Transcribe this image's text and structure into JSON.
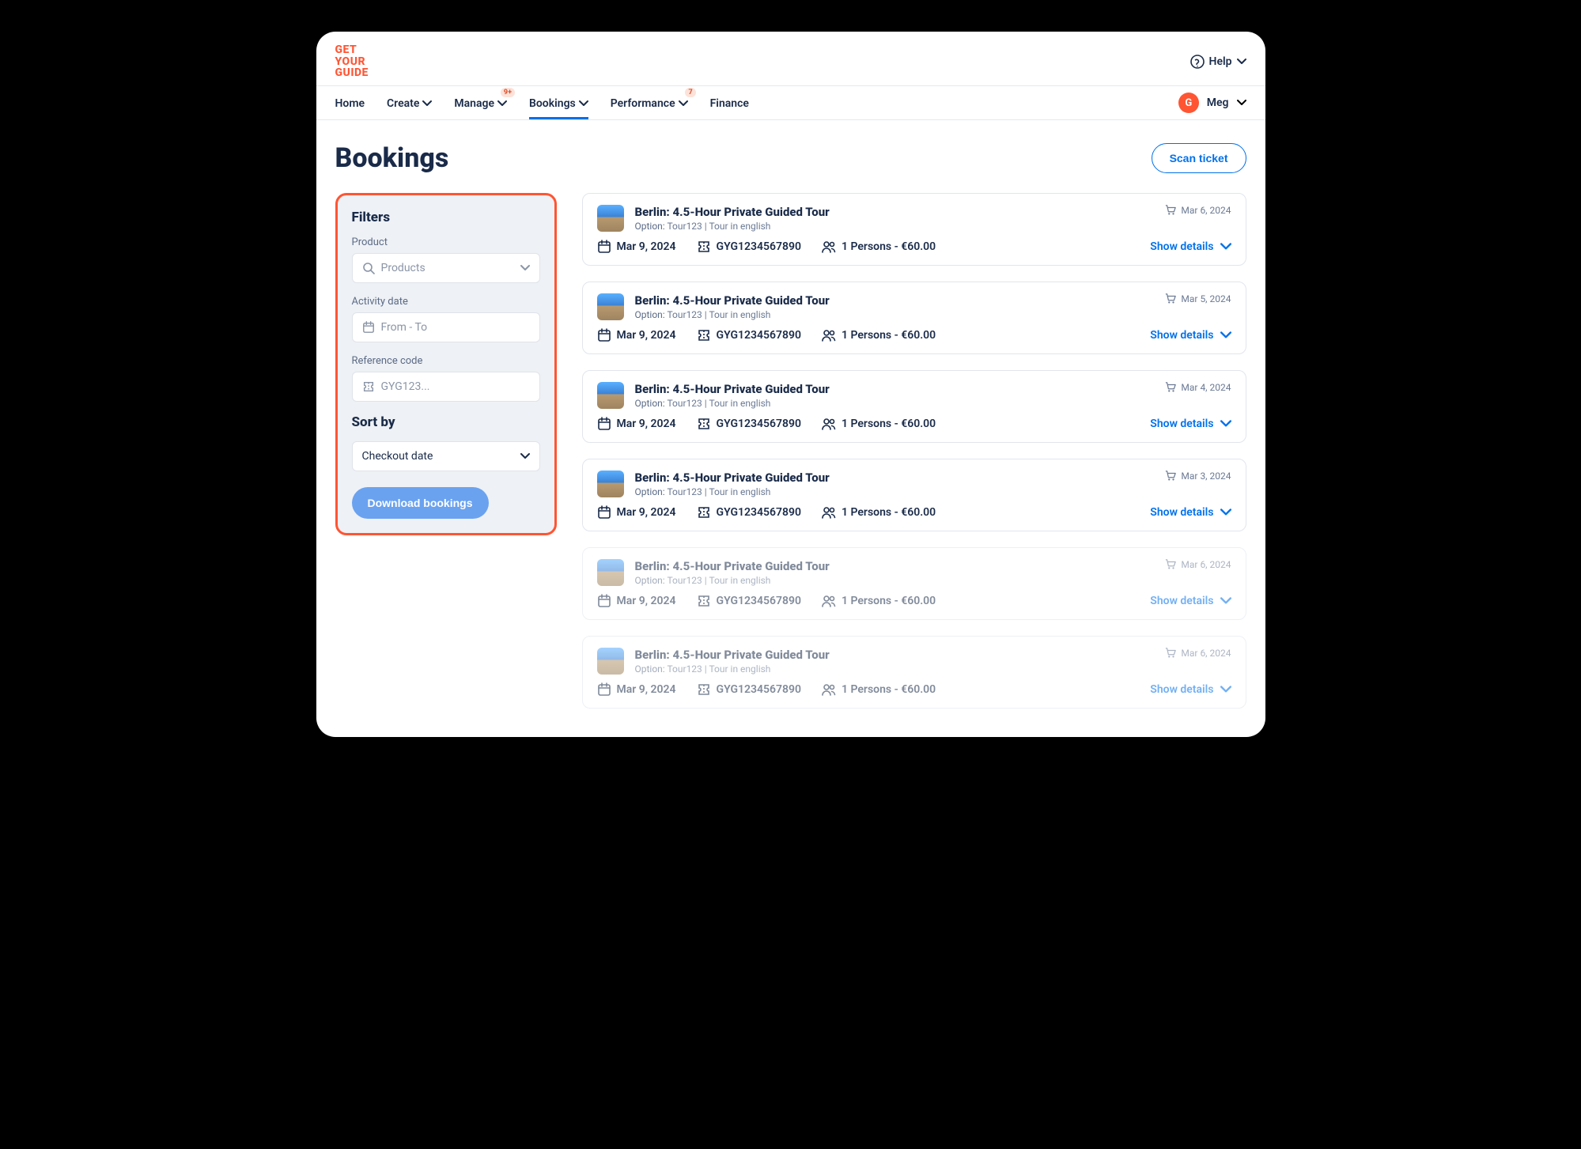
{
  "brand": {
    "line1": "GET",
    "line2": "YOUR",
    "line3": "GUIDE"
  },
  "help_label": "Help",
  "nav": {
    "items": [
      {
        "label": "Home",
        "dropdown": false,
        "badge": ""
      },
      {
        "label": "Create",
        "dropdown": true,
        "badge": ""
      },
      {
        "label": "Manage",
        "dropdown": true,
        "badge": "9+"
      },
      {
        "label": "Bookings",
        "dropdown": true,
        "badge": "",
        "active": true
      },
      {
        "label": "Performance",
        "dropdown": true,
        "badge": "7"
      },
      {
        "label": "Finance",
        "dropdown": false,
        "badge": ""
      }
    ]
  },
  "user": {
    "initial": "G",
    "name": "Meg"
  },
  "page": {
    "title": "Bookings",
    "scan_label": "Scan ticket"
  },
  "filters": {
    "heading": "Filters",
    "product_label": "Product",
    "product_placeholder": "Products",
    "date_label": "Activity date",
    "date_placeholder": "From - To",
    "ref_label": "Reference code",
    "ref_placeholder": "GYG123...",
    "sort_heading": "Sort by",
    "sort_value": "Checkout date",
    "download_label": "Download bookings"
  },
  "details_label": "Show details",
  "option_word": "Option:",
  "bookings": [
    {
      "title": "Berlin: 4.5-Hour Private Guided Tour",
      "option": "Tour123",
      "lang": "Tour in english",
      "checkout": "Mar 6, 2024",
      "date": "Mar 9, 2024",
      "ref": "GYG1234567890",
      "pax": "1 Persons - €60.00",
      "muted": false
    },
    {
      "title": "Berlin: 4.5-Hour Private Guided Tour",
      "option": "Tour123",
      "lang": "Tour in english",
      "checkout": "Mar 5, 2024",
      "date": "Mar 9, 2024",
      "ref": "GYG1234567890",
      "pax": "1 Persons - €60.00",
      "muted": false
    },
    {
      "title": "Berlin: 4.5-Hour Private Guided Tour",
      "option": "Tour123",
      "lang": "Tour in english",
      "checkout": "Mar 4, 2024",
      "date": "Mar 9, 2024",
      "ref": "GYG1234567890",
      "pax": "1 Persons - €60.00",
      "muted": false
    },
    {
      "title": "Berlin: 4.5-Hour Private Guided Tour",
      "option": "Tour123",
      "lang": "Tour in english",
      "checkout": "Mar 3, 2024",
      "date": "Mar 9, 2024",
      "ref": "GYG1234567890",
      "pax": "1 Persons - €60.00",
      "muted": false
    },
    {
      "title": "Berlin: 4.5-Hour Private Guided Tour",
      "option": "Tour123",
      "lang": "Tour in english",
      "checkout": "Mar 6, 2024",
      "date": "Mar 9, 2024",
      "ref": "GYG1234567890",
      "pax": "1 Persons - €60.00",
      "muted": true
    },
    {
      "title": "Berlin: 4.5-Hour Private Guided Tour",
      "option": "Tour123",
      "lang": "Tour in english",
      "checkout": "Mar 6, 2024",
      "date": "Mar 9, 2024",
      "ref": "GYG1234567890",
      "pax": "1 Persons - €60.00",
      "muted": true
    }
  ]
}
